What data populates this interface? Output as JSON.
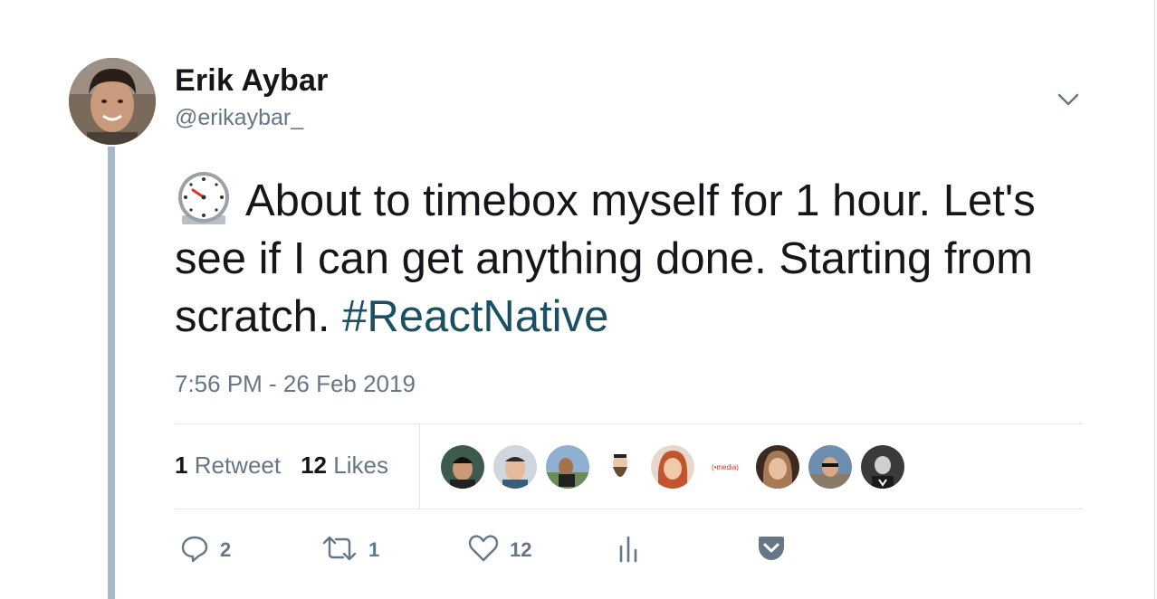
{
  "author": {
    "name": "Erik Aybar",
    "handle": "@erikaybar_"
  },
  "tweet": {
    "emoji": "alarm-clock",
    "text_before_hashtag": "About to timebox myself for 1 hour. Let's see if I can get anything done. Starting from scratch. ",
    "hashtag": "#ReactNative",
    "timestamp": "7:56 PM - 26 Feb 2019"
  },
  "stats": {
    "retweets_count": "1",
    "retweets_label": "Retweet",
    "likes_count": "12",
    "likes_label": "Likes"
  },
  "likers": [
    {
      "label": "liker-1",
      "color": "#3d5a4a"
    },
    {
      "label": "liker-2",
      "color": "#cfd6de"
    },
    {
      "label": "liker-3",
      "color": "#6c8a5a"
    },
    {
      "label": "liker-4",
      "color": "#f2f2f2"
    },
    {
      "label": "liker-5",
      "color": "#c97a5a"
    },
    {
      "label": "liker-6",
      "color": "#ffffff",
      "text": "(•media)"
    },
    {
      "label": "liker-7",
      "color": "#a57a55"
    },
    {
      "label": "liker-8",
      "color": "#6d8eae"
    },
    {
      "label": "liker-9",
      "color": "#3a3a3a"
    }
  ],
  "actions": {
    "reply_count": "2",
    "retweet_count": "1",
    "like_count": "12"
  },
  "colors": {
    "text_primary": "#14171a",
    "text_secondary": "#657786",
    "hashtag": "#1b4f63",
    "thread_line": "#a8b8c6",
    "icon": "#657786"
  },
  "icons": {
    "more": "chevron-down-icon",
    "reply": "reply-icon",
    "retweet": "retweet-icon",
    "like": "heart-icon",
    "analytics": "analytics-icon",
    "pocket": "pocket-icon"
  }
}
